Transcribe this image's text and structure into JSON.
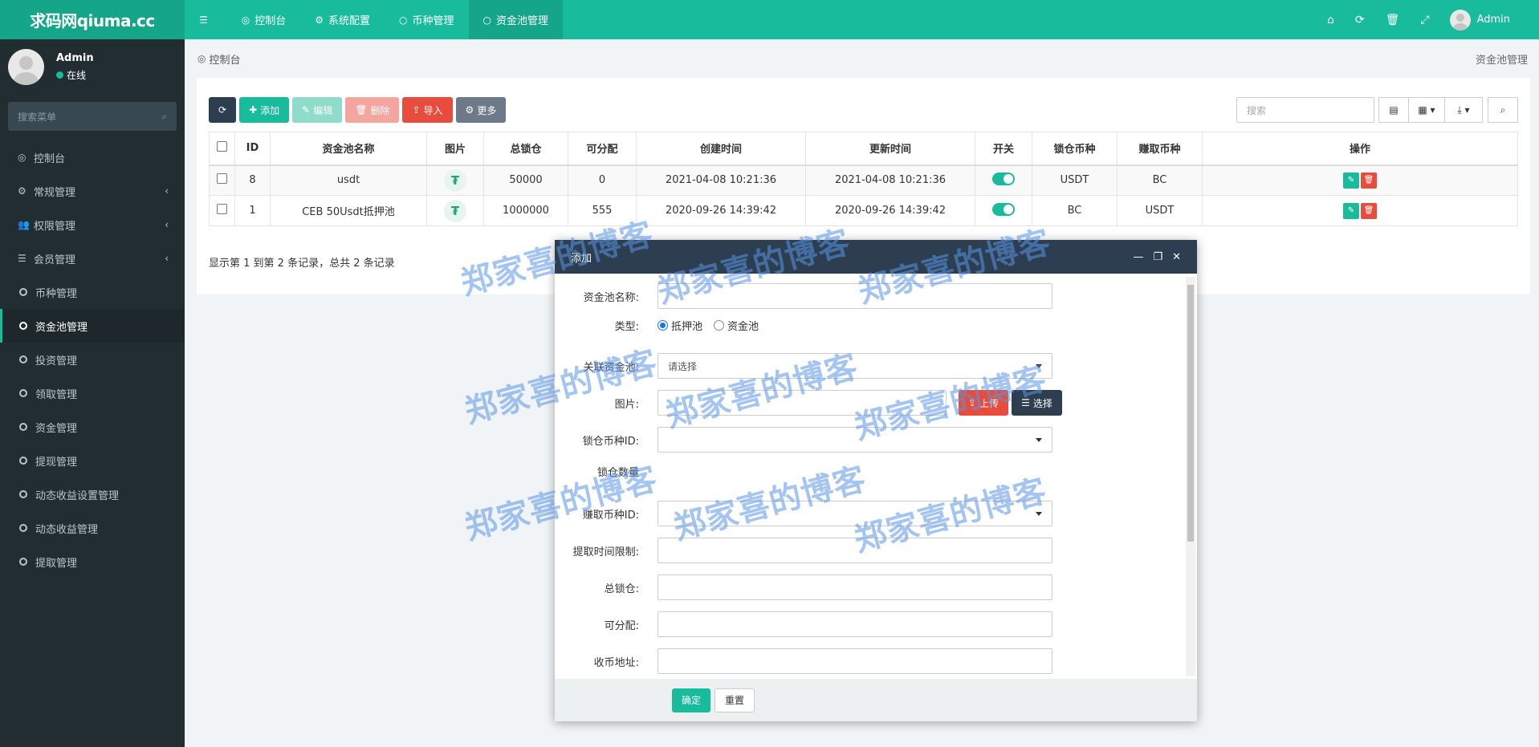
{
  "brand": {
    "logo": "求码网qiuma.cc"
  },
  "topnav": [
    {
      "icon": "☰",
      "label": ""
    },
    {
      "icon": "◎",
      "label": "控制台"
    },
    {
      "icon": "⚙",
      "label": "系统配置"
    },
    {
      "icon": "○",
      "label": "币种管理"
    },
    {
      "icon": "○",
      "label": "资金池管理"
    }
  ],
  "topright": {
    "user": "Admin"
  },
  "user": {
    "name": "Admin",
    "status": "在线"
  },
  "sidebar": {
    "search_placeholder": "搜索菜单",
    "items": [
      {
        "label": "控制台",
        "icon": "dashboard-icon",
        "glyph": "◎",
        "arrow": ""
      },
      {
        "label": "常规管理",
        "icon": "cogs-icon",
        "glyph": "⚙",
        "arrow": "‹"
      },
      {
        "label": "权限管理",
        "icon": "group-icon",
        "glyph": "👥",
        "arrow": "‹"
      },
      {
        "label": "会员管理",
        "icon": "list-icon",
        "glyph": "☰",
        "arrow": "‹"
      },
      {
        "label": "币种管理",
        "icon": "circle-icon",
        "glyph": "",
        "arrow": ""
      },
      {
        "label": "资金池管理",
        "icon": "circle-icon",
        "glyph": "",
        "arrow": "",
        "active": true
      },
      {
        "label": "投资管理",
        "icon": "circle-icon",
        "glyph": "",
        "arrow": ""
      },
      {
        "label": "领取管理",
        "icon": "circle-icon",
        "glyph": "",
        "arrow": ""
      },
      {
        "label": "资金管理",
        "icon": "circle-icon",
        "glyph": "",
        "arrow": ""
      },
      {
        "label": "提现管理",
        "icon": "circle-icon",
        "glyph": "",
        "arrow": ""
      },
      {
        "label": "动态收益设置管理",
        "icon": "circle-icon",
        "glyph": "",
        "arrow": ""
      },
      {
        "label": "动态收益管理",
        "icon": "circle-icon",
        "glyph": "",
        "arrow": ""
      },
      {
        "label": "提取管理",
        "icon": "circle-icon",
        "glyph": "",
        "arrow": ""
      }
    ]
  },
  "breadcrumb": {
    "left": "控制台",
    "right": "资金池管理"
  },
  "toolbar": {
    "add": "添加",
    "edit": "编辑",
    "delete": "删除",
    "import": "导入",
    "more": "更多",
    "search_placeholder": "搜索"
  },
  "table": {
    "headers": [
      "ID",
      "资金池名称",
      "图片",
      "总锁仓",
      "可分配",
      "创建时间",
      "更新时间",
      "开关",
      "锁仓币种",
      "赚取币种",
      "操作"
    ],
    "rows": [
      {
        "id": "8",
        "name": "usdt",
        "total": "50000",
        "dist": "0",
        "created": "2021-04-08 10:21:36",
        "updated": "2021-04-08 10:21:36",
        "lock": "USDT",
        "earn": "BC"
      },
      {
        "id": "1",
        "name": "CEB 50Usdt抵押池",
        "total": "1000000",
        "dist": "555",
        "created": "2020-09-26 14:39:42",
        "updated": "2020-09-26 14:39:42",
        "lock": "BC",
        "earn": "USDT"
      }
    ],
    "pageinfo": "显示第 1 到第 2 条记录，总共 2 条记录"
  },
  "modal": {
    "title": "添加",
    "fields": {
      "name": "资金池名称:",
      "type": "类型:",
      "type_opt1": "抵押池",
      "type_opt2": "资金池",
      "link": "关联资金池:",
      "link_value": "请选择",
      "image": "图片:",
      "upload": "上传",
      "choose": "选择",
      "lock_coin": "锁仓币种ID:",
      "lock_amount": "锁仓数量",
      "earn_coin": "赚取币种ID:",
      "time_limit": "提取时间限制:",
      "total": "总锁仓:",
      "dist": "可分配:",
      "address": "收币地址:"
    },
    "ok": "确定",
    "reset": "重置"
  },
  "watermark": "郑家喜的博客"
}
